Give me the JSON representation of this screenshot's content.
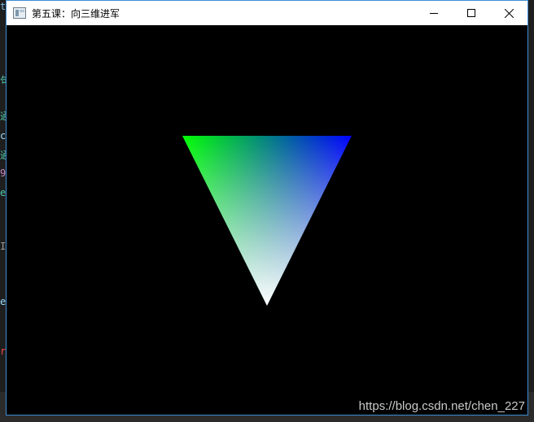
{
  "window": {
    "title": "第五课：向三维进军",
    "icon": "app-window-icon",
    "controls": {
      "minimize_icon": "minimize-icon",
      "maximize_icon": "maximize-icon",
      "close_icon": "close-icon"
    }
  },
  "canvas": {
    "background": "#000000",
    "triangle": {
      "vertex_colors": {
        "top_left": "#00ff00",
        "top_right": "#0000ff",
        "bottom": "#ffffff"
      }
    }
  },
  "watermark": "https://blog.csdn.net/chen_227",
  "background_editor": {
    "fragments": [
      "ta",
      "句",
      "通",
      "ce",
      "通",
      "9",
      "e(",
      "Ir",
      "es",
      "r"
    ]
  }
}
